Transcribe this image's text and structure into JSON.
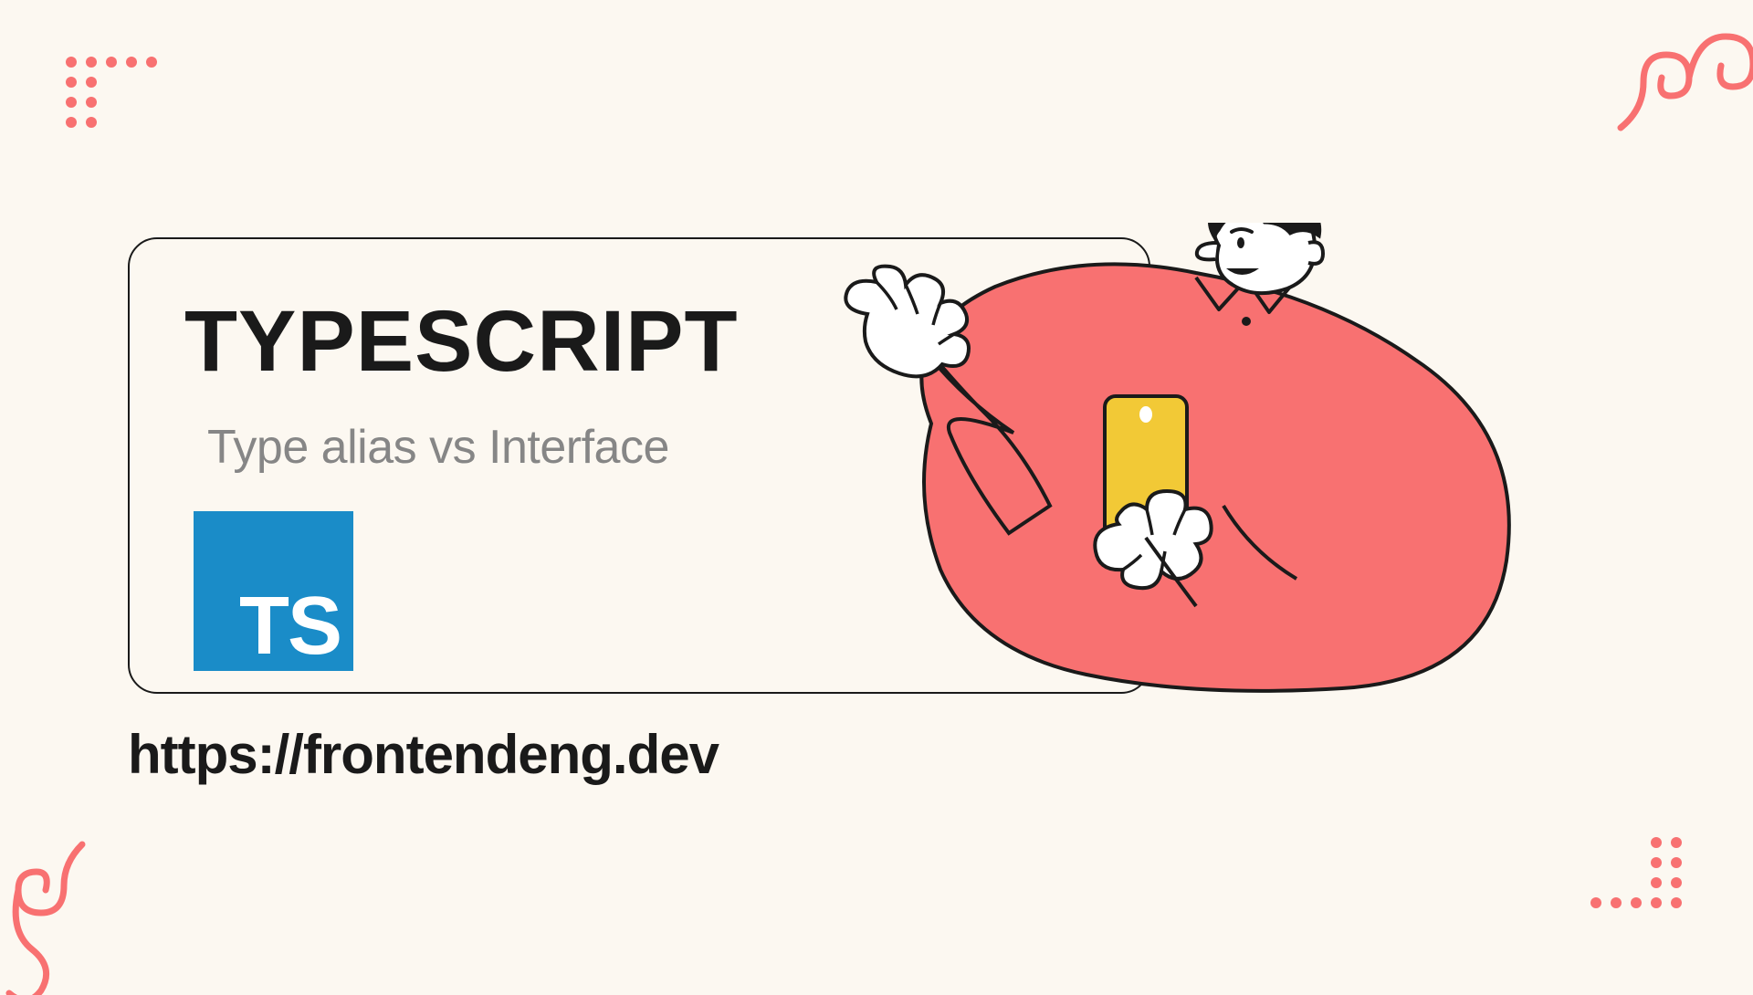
{
  "card": {
    "title": "TYPESCRIPT",
    "subtitle": "Type alias vs Interface",
    "logo_text": "TS"
  },
  "url": "https://frontendeng.dev",
  "colors": {
    "accent": "#f87171",
    "ts_blue": "#1a8cc8",
    "phone": "#f2c936",
    "bg": "#fcf8f1"
  }
}
